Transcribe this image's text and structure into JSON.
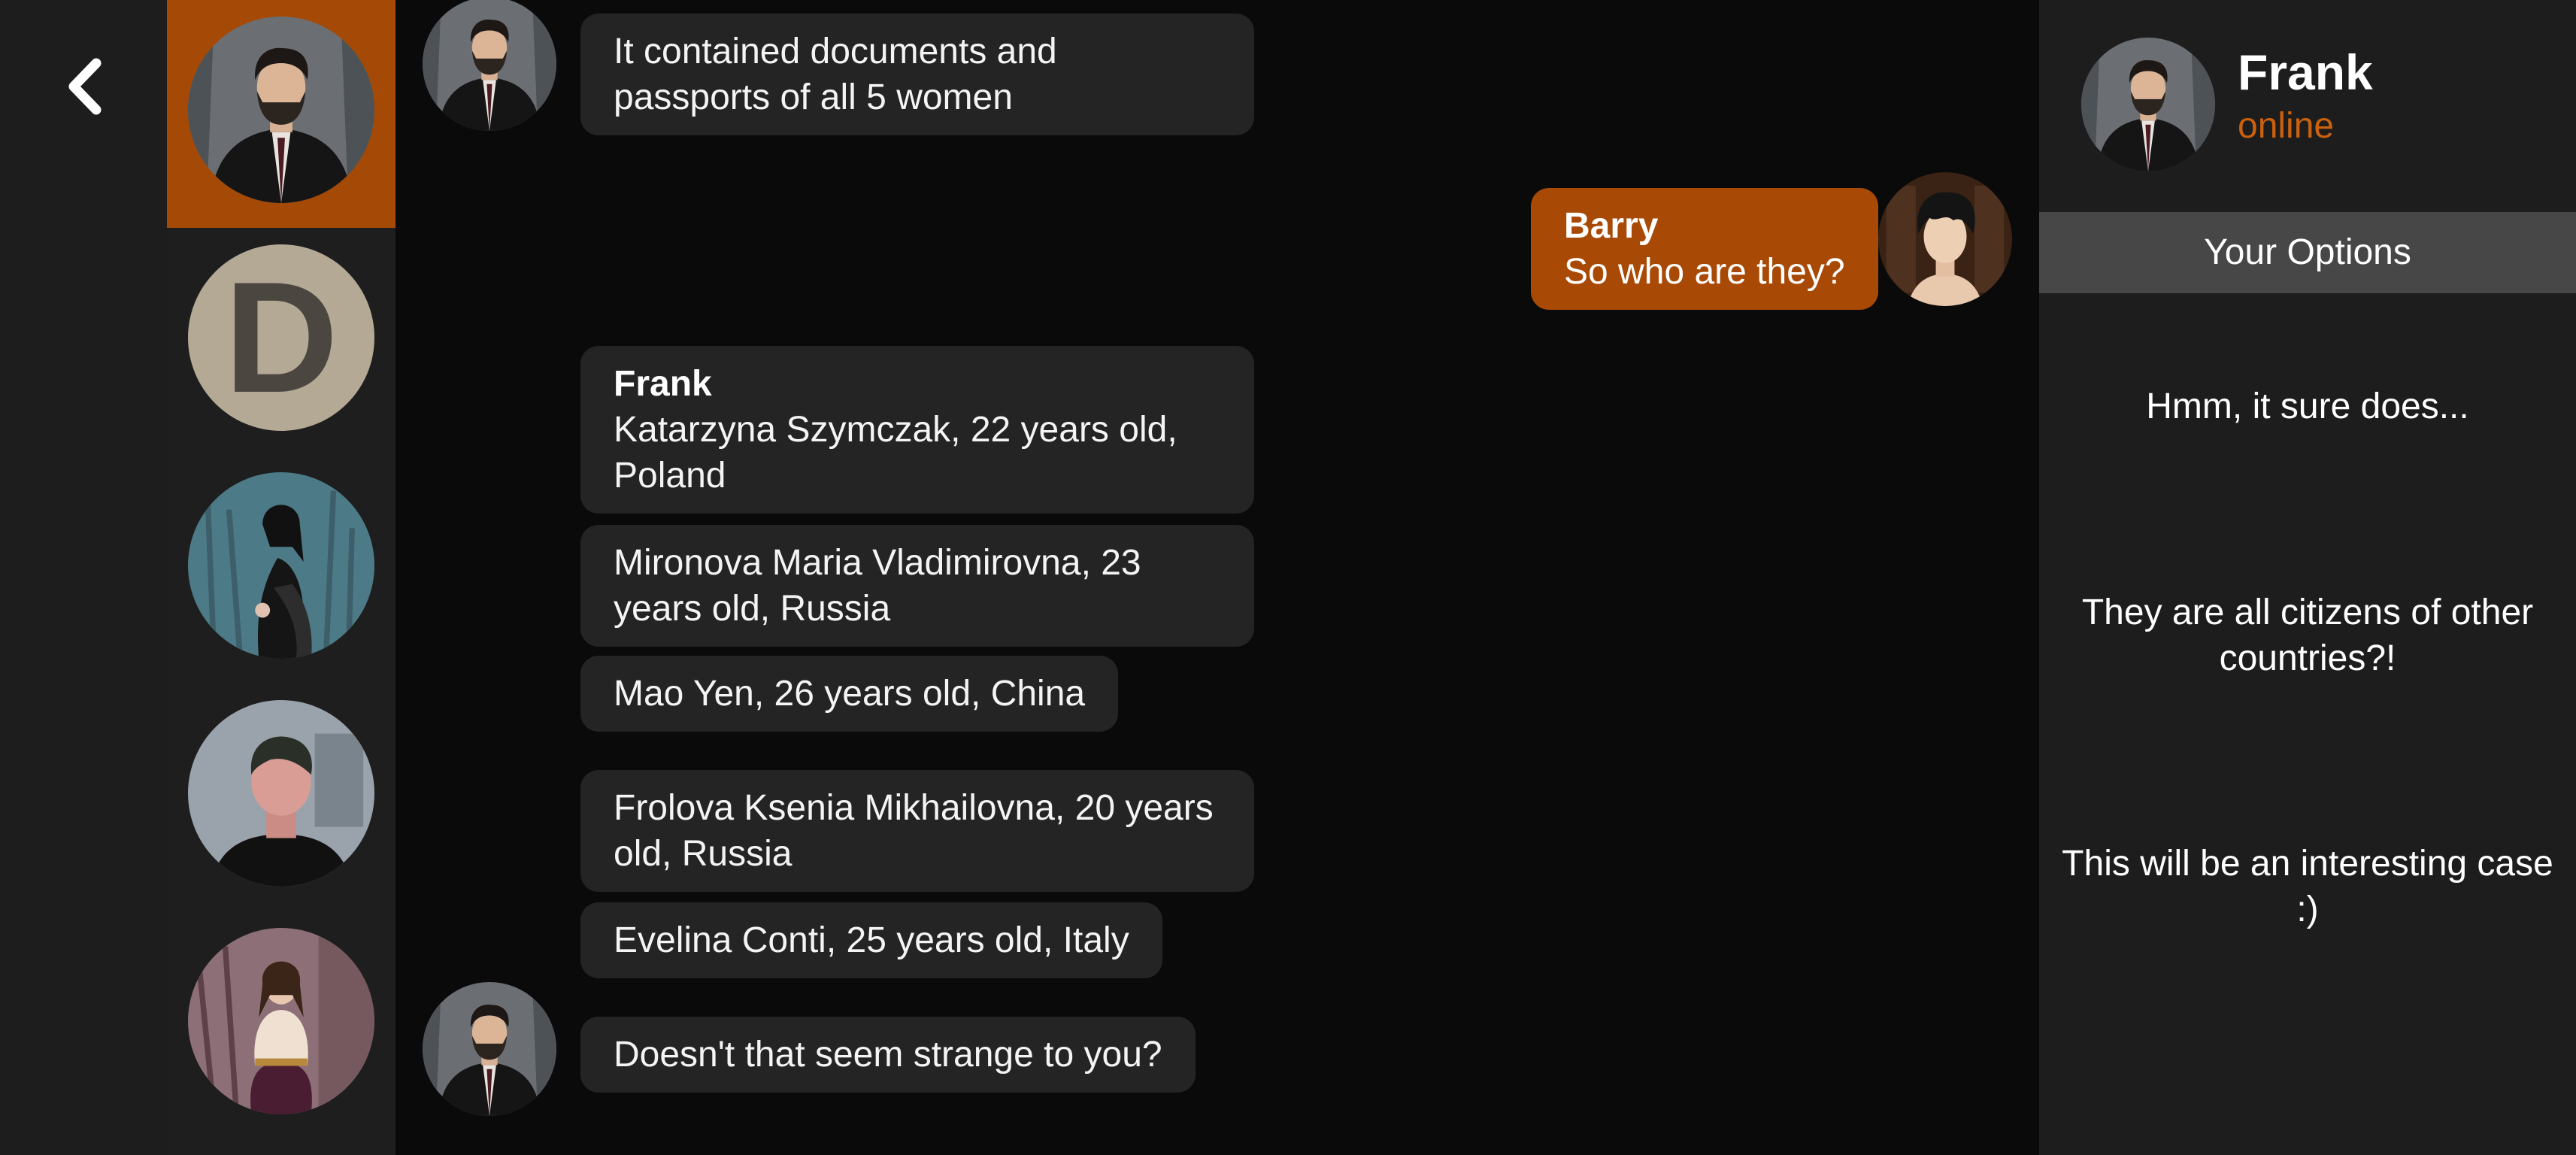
{
  "navigation": {
    "back_icon": "chevron-left-icon"
  },
  "contacts": [
    {
      "id": "frank",
      "active": true
    },
    {
      "id": "d",
      "initial": "D"
    },
    {
      "id": "woman-black-dress"
    },
    {
      "id": "man-black-tshirt"
    },
    {
      "id": "woman-beige-top"
    }
  ],
  "chat": {
    "messages": [
      {
        "from": "frank",
        "text": "It contained documents and passports of all 5 women"
      },
      {
        "from": "barry",
        "sender": "Barry",
        "text": "So who are they?"
      },
      {
        "from": "frank",
        "sender": "Frank",
        "text": "Katarzyna Szymczak, 22 years old, Poland"
      },
      {
        "from": "frank",
        "text": "Mironova Maria Vladimirovna, 23 years old, Russia"
      },
      {
        "from": "frank",
        "text": "Mao Yen, 26 years old, China"
      },
      {
        "from": "frank",
        "text": "Frolova Ksenia Mikhailovna, 20 years old, Russia"
      },
      {
        "from": "frank",
        "text": "Evelina Conti, 25 years old, Italy"
      },
      {
        "from": "frank",
        "text": "Doesn't that seem strange to you?"
      }
    ]
  },
  "panel": {
    "contact_name": "Frank",
    "status": "online",
    "options_header": "Your Options",
    "options": [
      "Hmm, it sure does...",
      "They are all citizens of other countries?!",
      "This will be an interesting case :)"
    ]
  },
  "colors": {
    "accent": "#a84a06",
    "status": "#c9610d",
    "bubble": "#242424",
    "panel": "#1d1d1d",
    "options_header": "#474747"
  }
}
